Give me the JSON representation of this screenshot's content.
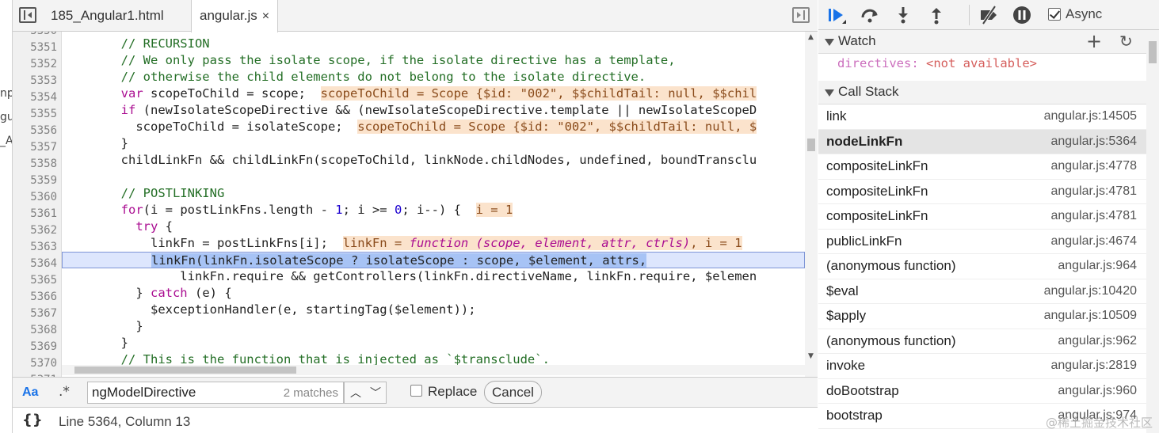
{
  "left_fragments": [
    "np",
    "gul",
    "_A"
  ],
  "tabs": [
    {
      "label": "185_Angular1.html",
      "active": false
    },
    {
      "label": "angular.js",
      "active": true,
      "close": "×"
    }
  ],
  "code": {
    "lines": [
      {
        "n": "5350",
        "text": ""
      },
      {
        "n": "5351",
        "text": ""
      },
      {
        "n": "5352",
        "text": ""
      },
      {
        "n": "5353",
        "text": ""
      },
      {
        "n": "5354",
        "text": ""
      },
      {
        "n": "5355",
        "text": ""
      },
      {
        "n": "5356",
        "text": ""
      },
      {
        "n": "5357",
        "text": ""
      },
      {
        "n": "5358",
        "text": ""
      },
      {
        "n": "5359",
        "text": ""
      },
      {
        "n": "5360",
        "text": ""
      },
      {
        "n": "5361",
        "text": ""
      },
      {
        "n": "5362",
        "text": ""
      },
      {
        "n": "5363",
        "text": ""
      },
      {
        "n": "5364",
        "text": ""
      },
      {
        "n": "5365",
        "text": ""
      },
      {
        "n": "5366",
        "text": ""
      },
      {
        "n": "5367",
        "text": ""
      },
      {
        "n": "5368",
        "text": ""
      },
      {
        "n": "5369",
        "text": ""
      },
      {
        "n": "5370",
        "text": ""
      },
      {
        "n": "5371",
        "text": ""
      }
    ],
    "l5351": "        // RECURSION",
    "l5352": "        // We only pass the isolate scope, if the isolate directive has a template,",
    "l5353": "        // otherwise the child elements do not belong to the isolate directive.",
    "l5354_a": "        var",
    "l5354_b": " scopeToChild = scope;  ",
    "l5354_inl": "scopeToChild = Scope {$id: \"002\", $$childTail: null, $$chil",
    "l5355_a": "        if",
    "l5355_b": " (newIsolateScopeDirective && (newIsolateScopeDirective.template || newIsolateScopeD",
    "l5356_b": "          scopeToChild = isolateScope;  ",
    "l5356_inl": "scopeToChild = Scope {$id: \"002\", $$childTail: null, $",
    "l5357": "        }",
    "l5358": "        childLinkFn && childLinkFn(scopeToChild, linkNode.childNodes, undefined, boundTransclu",
    "l5360": "        // POSTLINKING",
    "l5361_a": "        for",
    "l5361_b": "(i = postLinkFns.length - ",
    "l5361_c": "1",
    "l5361_d": "; i >= ",
    "l5361_e": "0",
    "l5361_f": "; i--) {  ",
    "l5361_inl": "i = 1",
    "l5362_a": "          try",
    "l5362_b": " {",
    "l5363_b": "            linkFn = postLinkFns[i];  ",
    "l5363_inl_a": "linkFn = ",
    "l5363_inl_b": "function (scope, element, attr, ctrls)",
    "l5363_inl_c": ", i = 1",
    "l5364_pre": "            ",
    "l5364_sel": "linkFn(linkFn.isolateScope ? isolateScope : scope, $element, attrs,",
    "l5365": "                linkFn.require && getControllers(linkFn.directiveName, linkFn.require, $elemen",
    "l5366_a": "          } ",
    "l5366_b": "catch",
    "l5366_c": " (e) {",
    "l5367": "            $exceptionHandler(e, startingTag($element));",
    "l5368": "          }",
    "l5369": "        }",
    "l5370": "        // This is the function that is injected as `$transclude`."
  },
  "find": {
    "aa": "Aa",
    "regex": ".*",
    "query": "ngModelDirective",
    "matches": "2 matches",
    "replace_label": "Replace",
    "cancel_label": "Cancel"
  },
  "status": {
    "braces": "{}",
    "position": "Line 5364, Column 13"
  },
  "debugger": {
    "async_label": "Async",
    "async_checked": true,
    "watch_title": "Watch",
    "watch_add": "+",
    "watch_refresh": "↻",
    "watch_key": "directives:",
    "watch_value": "<not available>",
    "callstack_title": "Call Stack",
    "frames": [
      {
        "fn": "link",
        "loc": "angular.js:14505"
      },
      {
        "fn": "nodeLinkFn",
        "loc": "angular.js:5364"
      },
      {
        "fn": "compositeLinkFn",
        "loc": "angular.js:4778"
      },
      {
        "fn": "compositeLinkFn",
        "loc": "angular.js:4781"
      },
      {
        "fn": "compositeLinkFn",
        "loc": "angular.js:4781"
      },
      {
        "fn": "publicLinkFn",
        "loc": "angular.js:4674"
      },
      {
        "fn": "(anonymous function)",
        "loc": "angular.js:964"
      },
      {
        "fn": "$eval",
        "loc": "angular.js:10420"
      },
      {
        "fn": "$apply",
        "loc": "angular.js:10509"
      },
      {
        "fn": "(anonymous function)",
        "loc": "angular.js:962"
      },
      {
        "fn": "invoke",
        "loc": "angular.js:2819"
      },
      {
        "fn": "doBootstrap",
        "loc": "angular.js:960"
      },
      {
        "fn": "bootstrap",
        "loc": "angular.js:974"
      }
    ],
    "selected_frame": 1,
    "watermark": "@稀土掘金技术社区"
  },
  "colors": {
    "highlight_line": "#dde6fd",
    "inline_value_bg": "#fbe3cc",
    "selection": "#a7c3f5",
    "comment": "#236e25",
    "keyword": "#aa0d91",
    "accent": "#1a73e8"
  },
  "icons": [
    "sidebar-toggle-icon",
    "close-icon",
    "resume-icon",
    "step-over-icon",
    "step-into-icon",
    "step-out-icon",
    "deactivate-breakpoints-icon",
    "pause-exceptions-icon",
    "add-icon",
    "refresh-icon",
    "chevron-up-icon",
    "chevron-down-icon"
  ]
}
